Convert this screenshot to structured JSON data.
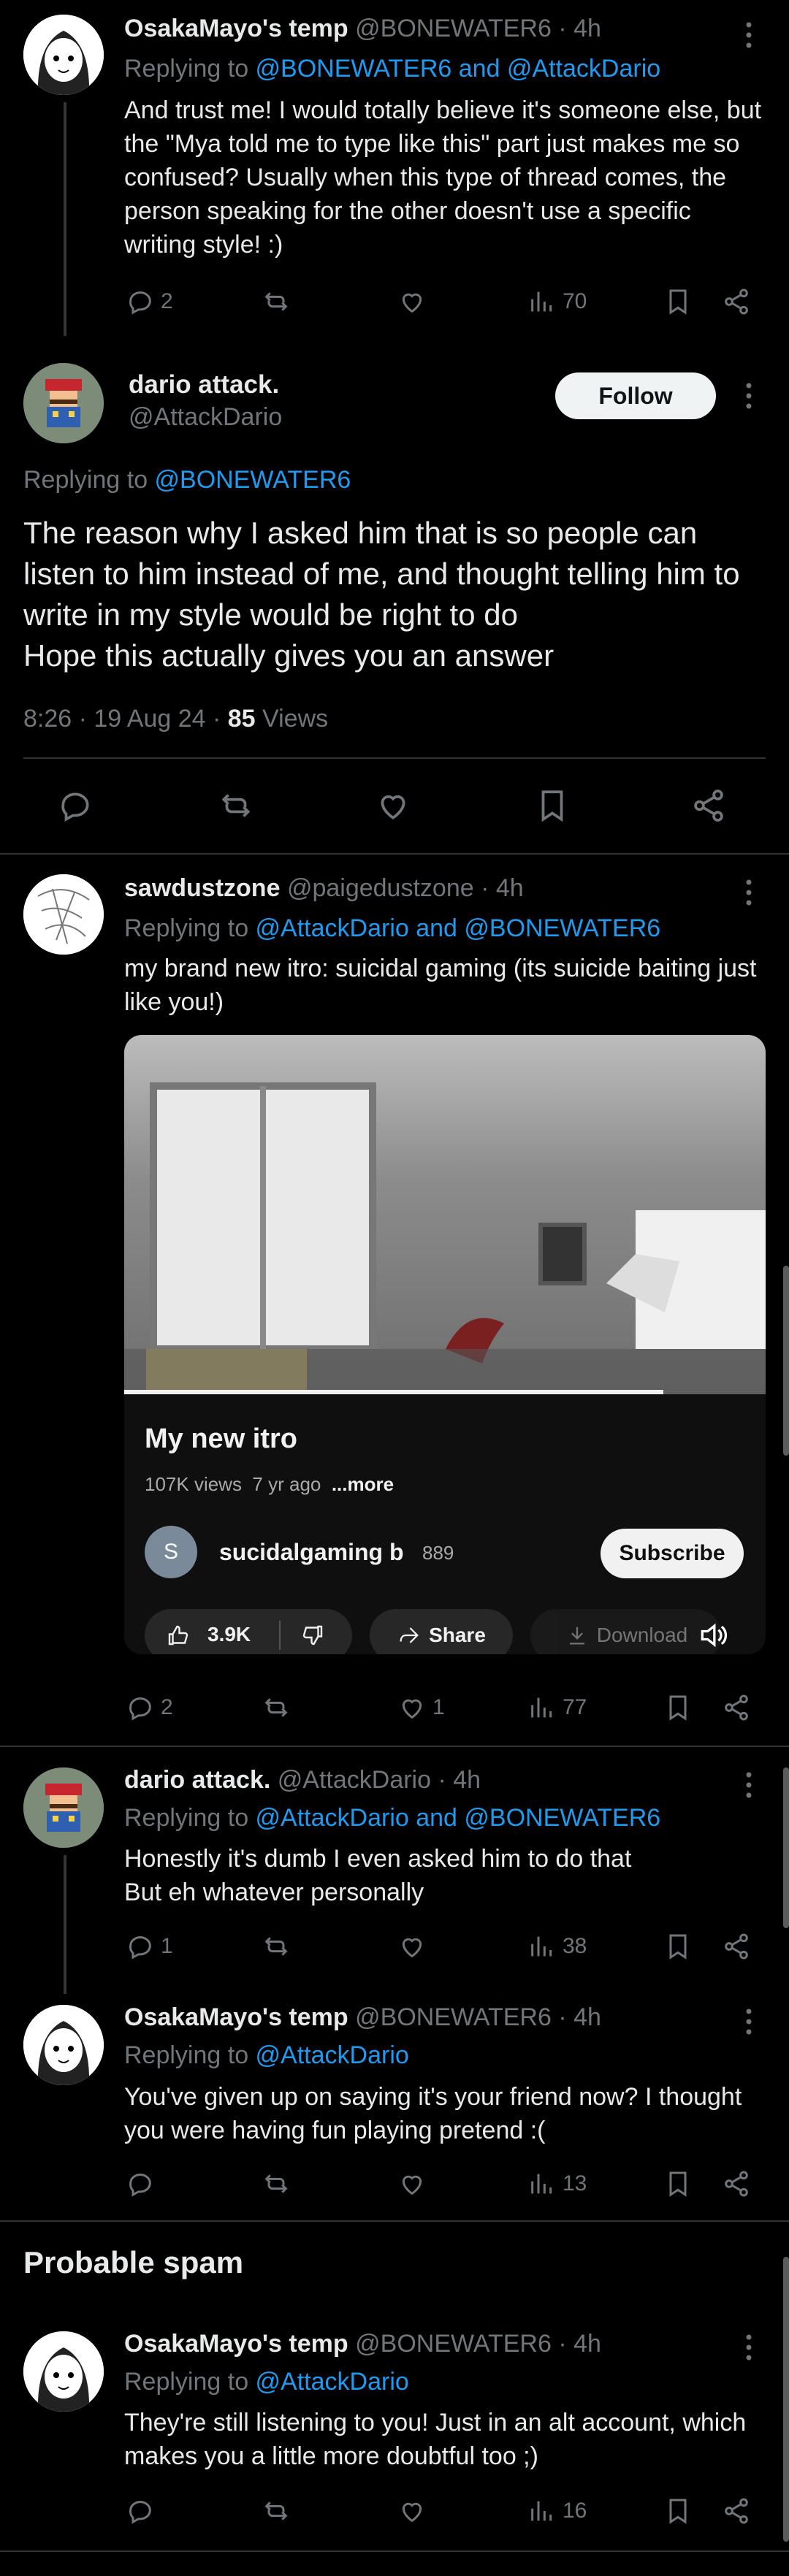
{
  "tweets": [
    {
      "name": "OsakaMayo's temp",
      "meta": "@BONEWATER6 · 4h",
      "reply_prefix": "Replying to ",
      "reply_to": "@BONEWATER6 and @AttackDario",
      "text": "And trust me! I would totally believe it's someone else, but the \"Mya told me to type like this\" part just makes me so confused? Usually when this type of thread comes, the person speaking for the other doesn't use a specific writing style! :)",
      "replies": "2",
      "reposts": "",
      "likes": "",
      "views": "70"
    },
    {
      "name": "sawdustzone",
      "meta": "@paigedustzone · 4h",
      "reply_prefix": "Replying to ",
      "reply_to": "@AttackDario and @BONEWATER6",
      "text": "my brand new itro: suicidal gaming (its suicide baiting just like you!)",
      "replies": "2",
      "reposts": "",
      "likes": "1",
      "views": "77"
    },
    {
      "name": "dario attack.",
      "meta": "@AttackDario · 4h",
      "reply_prefix": "Replying to ",
      "reply_to": "@AttackDario and @BONEWATER6",
      "text": "Honestly it's dumb I even asked him to do that\nBut eh whatever personally",
      "replies": "1",
      "reposts": "",
      "likes": "",
      "views": "38"
    },
    {
      "name": "OsakaMayo's temp",
      "meta": "@BONEWATER6 · 4h",
      "reply_prefix": "Replying to ",
      "reply_to": "@AttackDario",
      "text": "You've given up on saying it's your friend now? I thought you were having fun playing pretend :(",
      "replies": "",
      "reposts": "",
      "likes": "",
      "views": "13"
    },
    {
      "name": "OsakaMayo's temp",
      "meta": "@BONEWATER6 · 4h",
      "reply_prefix": "Replying to ",
      "reply_to": "@AttackDario",
      "text": "They're still listening to you! Just in an alt account, which makes you a little more doubtful too ;)",
      "replies": "",
      "reposts": "",
      "likes": "",
      "views": "16"
    }
  ],
  "focused": {
    "name": "dario attack.",
    "handle": "@AttackDario",
    "follow_label": "Follow",
    "reply_prefix": "Replying to ",
    "reply_to": "@BONEWATER6",
    "text": "The reason why I asked him that is so people can listen to him instead of me, and thought telling him to write in my style would be right to do\nHope this actually gives you an answer",
    "timestamp": "8:26 · 19 Aug 24 · ",
    "views_count": "85",
    "views_label": " Views"
  },
  "video": {
    "title": "My new itro",
    "views": "107K views",
    "age": "7 yr ago",
    "more": "...more",
    "channel_initial": "S",
    "channel": "sucidalgaming b",
    "subs": "889",
    "subscribe_label": "Subscribe",
    "likes": "3.9K",
    "share_label": "Share",
    "download_label": "Download"
  },
  "section": {
    "probable_spam": "Probable spam"
  },
  "colors": {
    "background": "#000000",
    "text": "#e7e9ea",
    "secondary": "#71767b",
    "link": "#1d9bf0",
    "divider": "#2f3336"
  }
}
